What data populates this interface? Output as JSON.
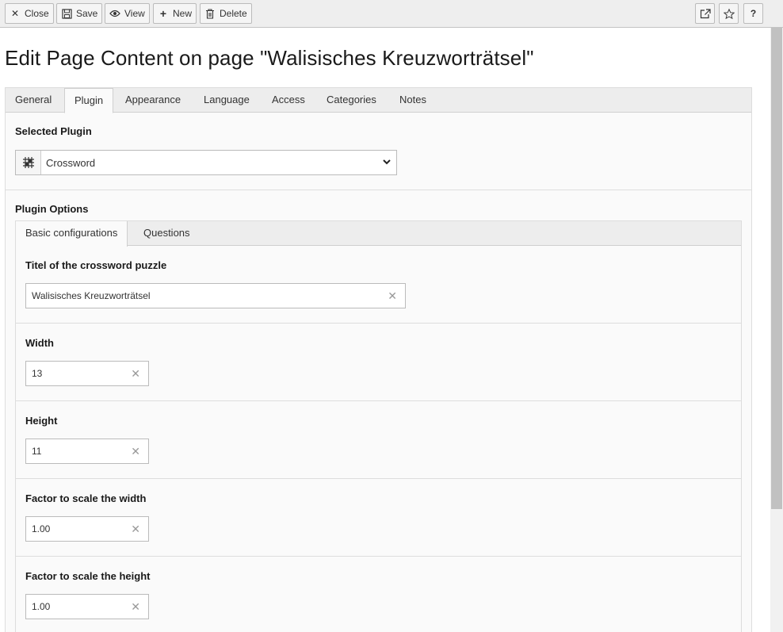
{
  "toolbar": {
    "close_label": "Close",
    "save_label": "Save",
    "view_label": "View",
    "new_label": "New",
    "delete_label": "Delete",
    "help_label": "?"
  },
  "page_title": "Edit Page Content on page \"Walisisches Kreuzworträtsel\"",
  "tabs": [
    {
      "label": "General"
    },
    {
      "label": "Plugin"
    },
    {
      "label": "Appearance"
    },
    {
      "label": "Language"
    },
    {
      "label": "Access"
    },
    {
      "label": "Categories"
    },
    {
      "label": "Notes"
    }
  ],
  "active_tab": "Plugin",
  "selected_plugin": {
    "label": "Selected Plugin",
    "value": "Crossword"
  },
  "plugin_options": {
    "label": "Plugin Options",
    "tabs": [
      {
        "label": "Basic configurations"
      },
      {
        "label": "Questions"
      }
    ],
    "fields": [
      {
        "label": "Titel of the crossword puzzle",
        "value": "Walisisches Kreuzworträtsel"
      },
      {
        "label": "Width",
        "value": "13"
      },
      {
        "label": "Height",
        "value": "11"
      },
      {
        "label": "Factor to scale the width",
        "value": "1.00"
      },
      {
        "label": "Factor to scale the height",
        "value": "1.00"
      }
    ]
  },
  "colors": {
    "toolbar_bg": "#eeeeee",
    "panel_bg": "#fafafa",
    "tab_bar_bg": "#ededed"
  }
}
